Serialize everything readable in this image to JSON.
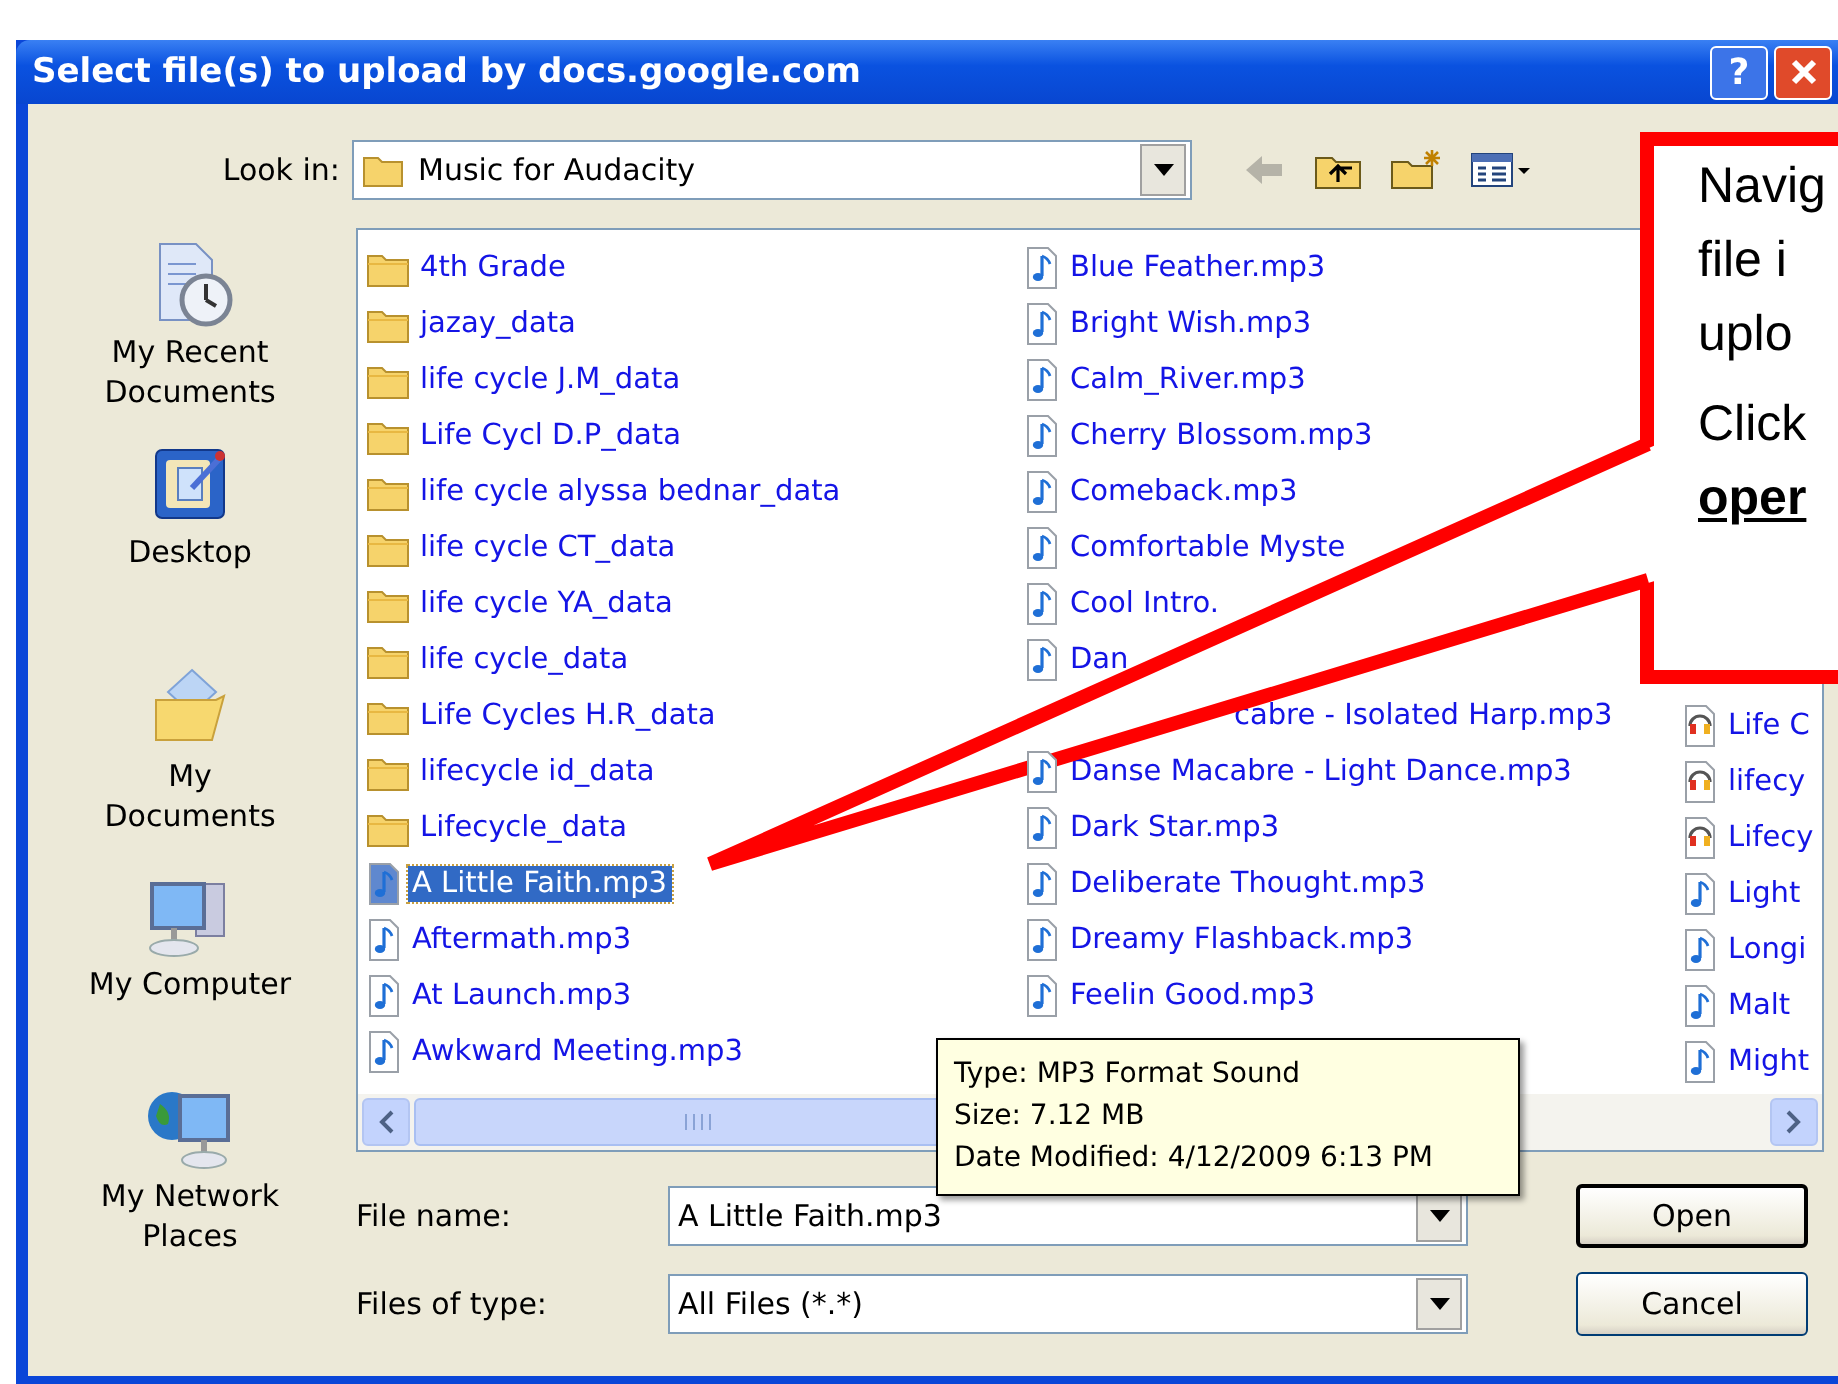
{
  "window": {
    "title": "Select file(s) to upload by docs.google.com",
    "help_button": "?"
  },
  "look_in": {
    "label": "Look in:",
    "value": "Music for Audacity"
  },
  "places": [
    {
      "label": "My Recent Documents",
      "kind": "recent"
    },
    {
      "label": "Desktop",
      "kind": "desktop"
    },
    {
      "label": "My Documents",
      "kind": "documents"
    },
    {
      "label": "My Computer",
      "kind": "computer"
    },
    {
      "label": "My Network Places",
      "kind": "network"
    }
  ],
  "file_list": {
    "columns": [
      [
        {
          "name": "4th Grade",
          "kind": "folder",
          "selected": false
        },
        {
          "name": "jazay_data",
          "kind": "folder",
          "selected": false
        },
        {
          "name": "life  cycle  J.M_data",
          "kind": "folder",
          "selected": false
        },
        {
          "name": "Life Cycl D.P_data",
          "kind": "folder",
          "selected": false
        },
        {
          "name": "life cycle   alyssa  bednar_data",
          "kind": "folder",
          "selected": false
        },
        {
          "name": "life cycle CT_data",
          "kind": "folder",
          "selected": false
        },
        {
          "name": "life cycle YA_data",
          "kind": "folder",
          "selected": false
        },
        {
          "name": "life cycle_data",
          "kind": "folder",
          "selected": false
        },
        {
          "name": "Life Cycles H.R_data",
          "kind": "folder",
          "selected": false
        },
        {
          "name": "lifecycle  id_data",
          "kind": "folder",
          "selected": false
        },
        {
          "name": "Lifecycle_data",
          "kind": "folder",
          "selected": false
        },
        {
          "name": "A Little Faith.mp3",
          "kind": "audio",
          "selected": true
        },
        {
          "name": "Aftermath.mp3",
          "kind": "audio",
          "selected": false
        },
        {
          "name": "At Launch.mp3",
          "kind": "audio",
          "selected": false
        },
        {
          "name": "Awkward Meeting.mp3",
          "kind": "audio",
          "selected": false
        }
      ],
      [
        {
          "name": "Blue Feather.mp3",
          "kind": "audio",
          "selected": false
        },
        {
          "name": "Bright Wish.mp3",
          "kind": "audio",
          "selected": false
        },
        {
          "name": "Calm_River.mp3",
          "kind": "audio",
          "selected": false
        },
        {
          "name": "Cherry Blossom.mp3",
          "kind": "audio",
          "selected": false
        },
        {
          "name": "Comeback.mp3",
          "kind": "audio",
          "selected": false
        },
        {
          "name": "Comfortable Myste",
          "kind": "audio",
          "selected": false
        },
        {
          "name": "Cool Intro.",
          "kind": "audio",
          "selected": false
        },
        {
          "name": "Dan",
          "kind": "audio",
          "selected": false
        },
        {
          "name": "cabre - Isolated Harp.mp3",
          "kind": "covered",
          "selected": false
        },
        {
          "name": "Danse Macabre - Light Dance.mp3",
          "kind": "audio",
          "selected": false
        },
        {
          "name": "Dark Star.mp3",
          "kind": "audio",
          "selected": false
        },
        {
          "name": "Deliberate Thought.mp3",
          "kind": "audio",
          "selected": false
        },
        {
          "name": "Dreamy Flashback.mp3",
          "kind": "audio",
          "selected": false
        },
        {
          "name": "Feelin Good.mp3",
          "kind": "audio",
          "selected": false
        }
      ],
      [
        {
          "name": "Life C",
          "kind": "project",
          "selected": false
        },
        {
          "name": "lifecy",
          "kind": "project",
          "selected": false
        },
        {
          "name": "Lifecy",
          "kind": "project",
          "selected": false
        },
        {
          "name": "Light",
          "kind": "audio",
          "selected": false
        },
        {
          "name": "Longi",
          "kind": "audio",
          "selected": false
        },
        {
          "name": "Malt",
          "kind": "audio",
          "selected": false
        },
        {
          "name": "Might",
          "kind": "audio",
          "selected": false
        }
      ]
    ]
  },
  "tooltip": {
    "lines": [
      "Type: MP3 Format Sound",
      "Size: 7.12 MB",
      "Date Modified: 4/12/2009 6:13 PM"
    ]
  },
  "file_name": {
    "label": "File name:",
    "value": "A Little Faith.mp3"
  },
  "file_type": {
    "label": "Files of type:",
    "value": "All Files (*.*)"
  },
  "buttons": [
    {
      "label": "Open",
      "default": true
    },
    {
      "label": "Cancel",
      "default": false
    }
  ],
  "callout": {
    "paragraphs": [
      [
        {
          "text": "Navig",
          "emphasis": false
        },
        {
          "text": "file i",
          "emphasis": false
        },
        {
          "text": "uplo",
          "emphasis": false
        }
      ],
      [
        {
          "text": "Click",
          "emphasis": false
        },
        {
          "text": "oper",
          "emphasis": true
        }
      ]
    ]
  }
}
